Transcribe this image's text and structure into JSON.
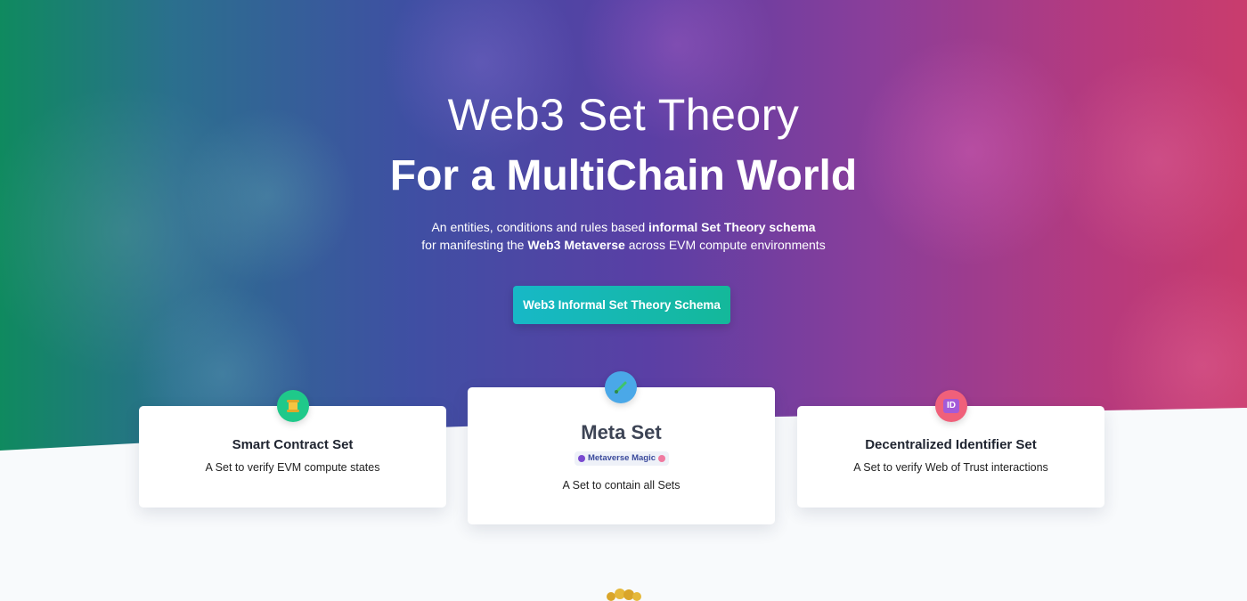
{
  "hero": {
    "title_light": "Web3 Set Theory",
    "title_bold": "For a MultiChain World",
    "desc_line1_pre": "An entities, conditions and rules based ",
    "desc_line1_bold": "informal Set Theory schema",
    "desc_line2_pre": "for manifesting the ",
    "desc_line2_bold": "Web3 Metaverse",
    "desc_line2_post": " across EVM compute environments",
    "cta_label": "Web3 Informal Set Theory Schema"
  },
  "cards": [
    {
      "title": "Smart Contract Set",
      "text": "A Set to verify EVM compute states",
      "icon": "scroll-icon"
    },
    {
      "title": "Meta Set",
      "badge": "Metaverse Magic",
      "text": "A Set to contain all Sets",
      "icon": "brush-icon"
    },
    {
      "title": "Decentralized Identifier Set",
      "text": "A Set to verify Web of Trust interactions",
      "icon": "id-icon"
    }
  ],
  "colors": {
    "card1_icon": "#1fc98a",
    "card2_icon": "#4aa8e8",
    "card3_icon": "#f0607a",
    "cta_start": "#17b8c7",
    "cta_end": "#14b89a"
  }
}
